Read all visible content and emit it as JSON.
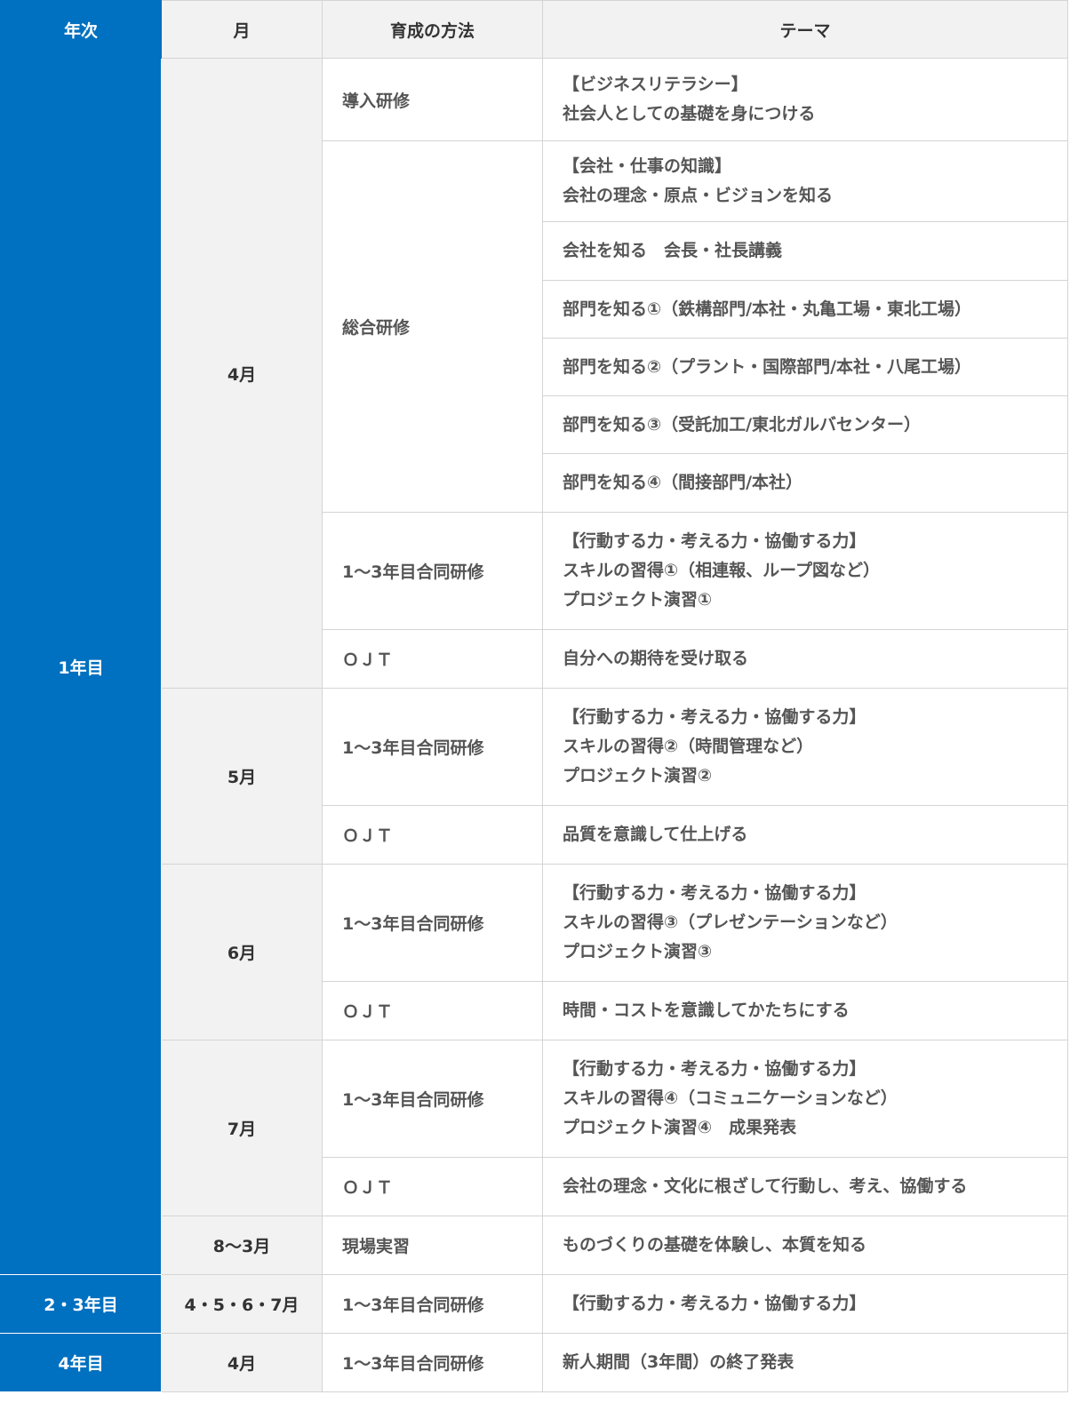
{
  "headers": {
    "year": "年次",
    "month": "月",
    "method": "育成の方法",
    "theme": "テーマ"
  },
  "rows": [
    {
      "year": "1年目",
      "month": "4月",
      "method": "導入研修",
      "theme": [
        "【ビジネスリテラシー】",
        "社会人としての基礎を身につける"
      ]
    },
    {
      "method": "総合研修",
      "theme": [
        "【会社・仕事の知識】",
        "会社の理念・原点・ビジョンを知る"
      ]
    },
    {
      "theme": [
        "会社を知る　会長・社長講義"
      ]
    },
    {
      "theme": [
        "部門を知る①（鉄構部門/本社・丸亀工場・東北工場）"
      ]
    },
    {
      "theme": [
        "部門を知る②（プラント・国際部門/本社・八尾工場）"
      ]
    },
    {
      "theme": [
        "部門を知る③（受託加工/東北ガルバセンター）"
      ]
    },
    {
      "theme": [
        "部門を知る④（間接部門/本社）"
      ]
    },
    {
      "method": "1～3年目合同研修",
      "theme": [
        "【行動する力・考える力・協働する力】",
        "スキルの習得①（相連報、ループ図など）",
        "プロジェクト演習①"
      ]
    },
    {
      "method": "ＯＪＴ",
      "theme": [
        "自分への期待を受け取る"
      ]
    },
    {
      "month": "5月",
      "method": "1～3年目合同研修",
      "theme": [
        "【行動する力・考える力・協働する力】",
        "スキルの習得②（時間管理など）",
        "プロジェクト演習②"
      ]
    },
    {
      "method": "ＯＪＴ",
      "theme": [
        "品質を意識して仕上げる"
      ]
    },
    {
      "month": "6月",
      "method": "1～3年目合同研修",
      "theme": [
        "【行動する力・考える力・協働する力】",
        "スキルの習得③（プレゼンテーションなど）",
        "プロジェクト演習③"
      ]
    },
    {
      "method": "ＯＪＴ",
      "theme": [
        "時間・コストを意識してかたちにする"
      ]
    },
    {
      "month": "7月",
      "method": "1～3年目合同研修",
      "theme": [
        "【行動する力・考える力・協働する力】",
        "スキルの習得④（コミュニケーションなど）",
        "プロジェクト演習④　成果発表"
      ]
    },
    {
      "method": "ＯＪＴ",
      "theme": [
        "会社の理念・文化に根ざして行動し、考え、協働する"
      ]
    },
    {
      "month": "8～3月",
      "method": "現場実習",
      "theme": [
        "ものづくりの基礎を体験し、本質を知る"
      ]
    },
    {
      "year": "2・3年目",
      "month": "4・5・6・7月",
      "method": "1～3年目合同研修",
      "theme": [
        "【行動する力・考える力・協働する力】"
      ]
    },
    {
      "year": "4年目",
      "month": "4月",
      "method": "1～3年目合同研修",
      "theme": [
        "新人期間（3年間）の終了発表"
      ]
    }
  ],
  "colors": {
    "year_bg": "#0070c0",
    "month_bg": "#f2f2f2",
    "border": "#d4d4d4",
    "text": "#555555"
  }
}
